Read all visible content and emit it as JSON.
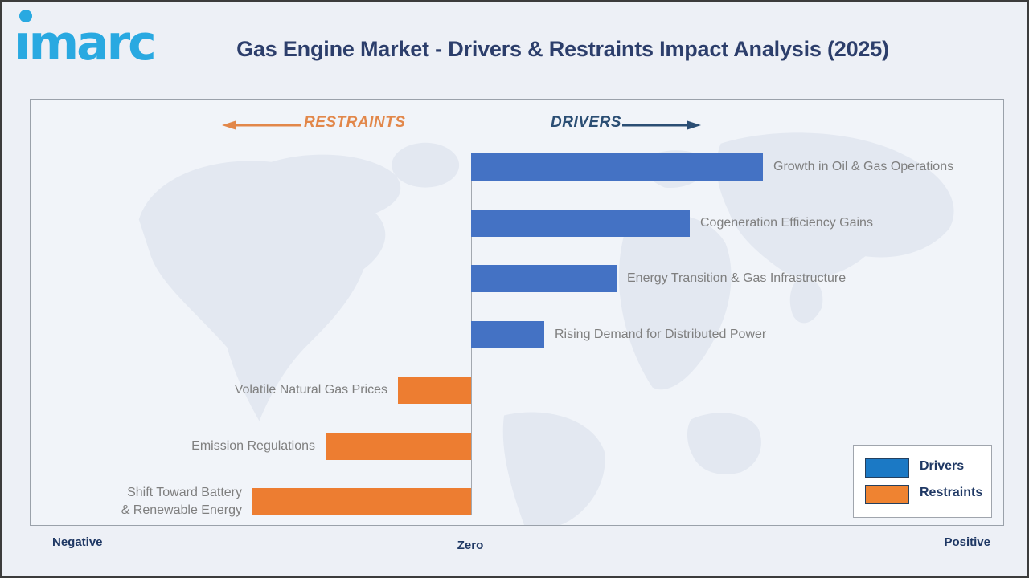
{
  "page": {
    "brand": "imarc",
    "title": "Gas Engine Market - Drivers & Restraints Impact Analysis (2025)"
  },
  "direction_labels": {
    "restraints": "RESTRAINTS",
    "drivers": "DRIVERS"
  },
  "axis": {
    "negative": "Negative",
    "zero": "Zero",
    "positive": "Positive"
  },
  "legend": {
    "items": [
      {
        "label": "Drivers",
        "color": "#1B79C5"
      },
      {
        "label": "Restraints",
        "color": "#EF8331"
      }
    ]
  },
  "colors": {
    "page_bg": "#EDF0F6",
    "panel_bg": "#F1F4F9",
    "panel_border": "#9AA1AA",
    "frame": "#3C3C3C",
    "brand_blue": "#29A9E1",
    "title_navy": "#2C3E6B",
    "axis_navy": "#1F3864",
    "label_gray": "#7F7F7F",
    "bar_blue": "#4472C4",
    "bar_orange": "#ED7D31",
    "legend_blue": "#1B79C5",
    "legend_orange": "#EF8331",
    "arrow_orange": "#E2874A",
    "arrow_navy": "#2B4E74",
    "zero_line": "#A3A8B0",
    "swatch_border": "#24405F",
    "map_land": "#E3E8F1"
  },
  "chart_data": {
    "type": "bar",
    "orientation": "horizontal-diverging",
    "title": "Gas Engine Market - Drivers & Restraints Impact Analysis (2025)",
    "xlabel_left": "Negative",
    "xlabel_center": "Zero",
    "xlabel_right": "Positive",
    "xlim": [
      -4,
      4
    ],
    "grid": false,
    "legend_position": "bottom-right",
    "value_note": "relative impact estimated from bar lengths (no numeric axis shown)",
    "series": [
      {
        "name": "Drivers",
        "color": "#4472C4",
        "items": [
          {
            "label": "Growth in Oil & Gas Operations",
            "value": 4
          },
          {
            "label": "Cogeneration Efficiency Gains",
            "value": 3
          },
          {
            "label": "Energy Transition & Gas Infrastructure",
            "value": 2
          },
          {
            "label": "Rising Demand for Distributed Power",
            "value": 1
          }
        ]
      },
      {
        "name": "Restraints",
        "color": "#ED7D31",
        "items": [
          {
            "label": "Volatile Natural Gas Prices",
            "value": -1
          },
          {
            "label": "Emission Regulations",
            "value": -2
          },
          {
            "label": "Shift Toward Battery\n& Renewable Energy",
            "value": -3
          }
        ]
      }
    ]
  }
}
